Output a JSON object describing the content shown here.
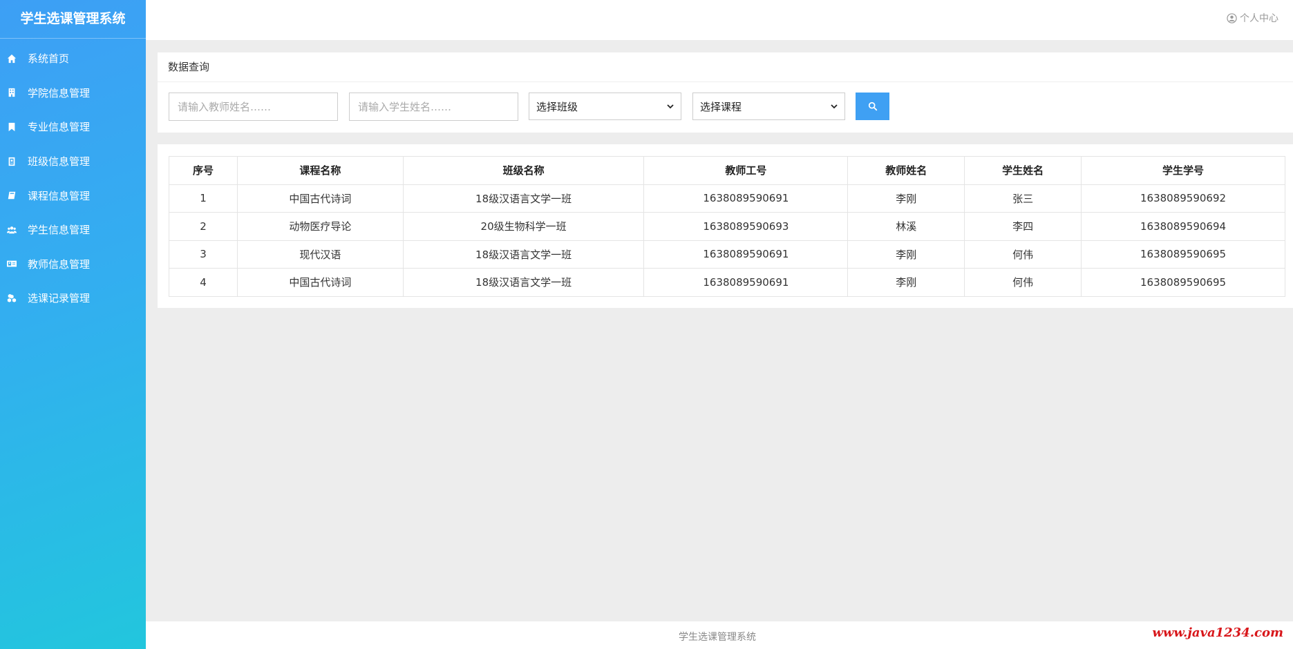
{
  "sidebar": {
    "title": "学生选课管理系统",
    "items": [
      {
        "label": "系统首页",
        "icon": "home-icon"
      },
      {
        "label": "学院信息管理",
        "icon": "building-icon"
      },
      {
        "label": "专业信息管理",
        "icon": "bookmark-icon"
      },
      {
        "label": "班级信息管理",
        "icon": "id-badge-icon"
      },
      {
        "label": "课程信息管理",
        "icon": "book-icon"
      },
      {
        "label": "学生信息管理",
        "icon": "users-icon"
      },
      {
        "label": "教师信息管理",
        "icon": "id-card-icon"
      },
      {
        "label": "选课记录管理",
        "icon": "cubes-icon"
      }
    ]
  },
  "header": {
    "user_center": "个人中心"
  },
  "search": {
    "title": "数据查询",
    "teacher_placeholder": "请输入教师姓名……",
    "student_placeholder": "请输入学生姓名……",
    "class_select": "选择班级",
    "course_select": "选择课程"
  },
  "table": {
    "headers": [
      "序号",
      "课程名称",
      "班级名称",
      "教师工号",
      "教师姓名",
      "学生姓名",
      "学生学号"
    ],
    "rows": [
      [
        "1",
        "中国古代诗词",
        "18级汉语言文学一班",
        "1638089590691",
        "李刚",
        "张三",
        "1638089590692"
      ],
      [
        "2",
        "动物医疗导论",
        "20级生物科学一班",
        "1638089590693",
        "林溪",
        "李四",
        "1638089590694"
      ],
      [
        "3",
        "现代汉语",
        "18级汉语言文学一班",
        "1638089590691",
        "李刚",
        "何伟",
        "1638089590695"
      ],
      [
        "4",
        "中国古代诗词",
        "18级汉语言文学一班",
        "1638089590691",
        "李刚",
        "何伟",
        "1638089590695"
      ]
    ]
  },
  "footer": {
    "text": "学生选课管理系统",
    "watermark": "www.java1234.com"
  },
  "colors": {
    "accent": "#3fa0f3",
    "sidebar_top": "#3d9ff5",
    "sidebar_bottom": "#22c6dd",
    "watermark": "#d8161a"
  }
}
